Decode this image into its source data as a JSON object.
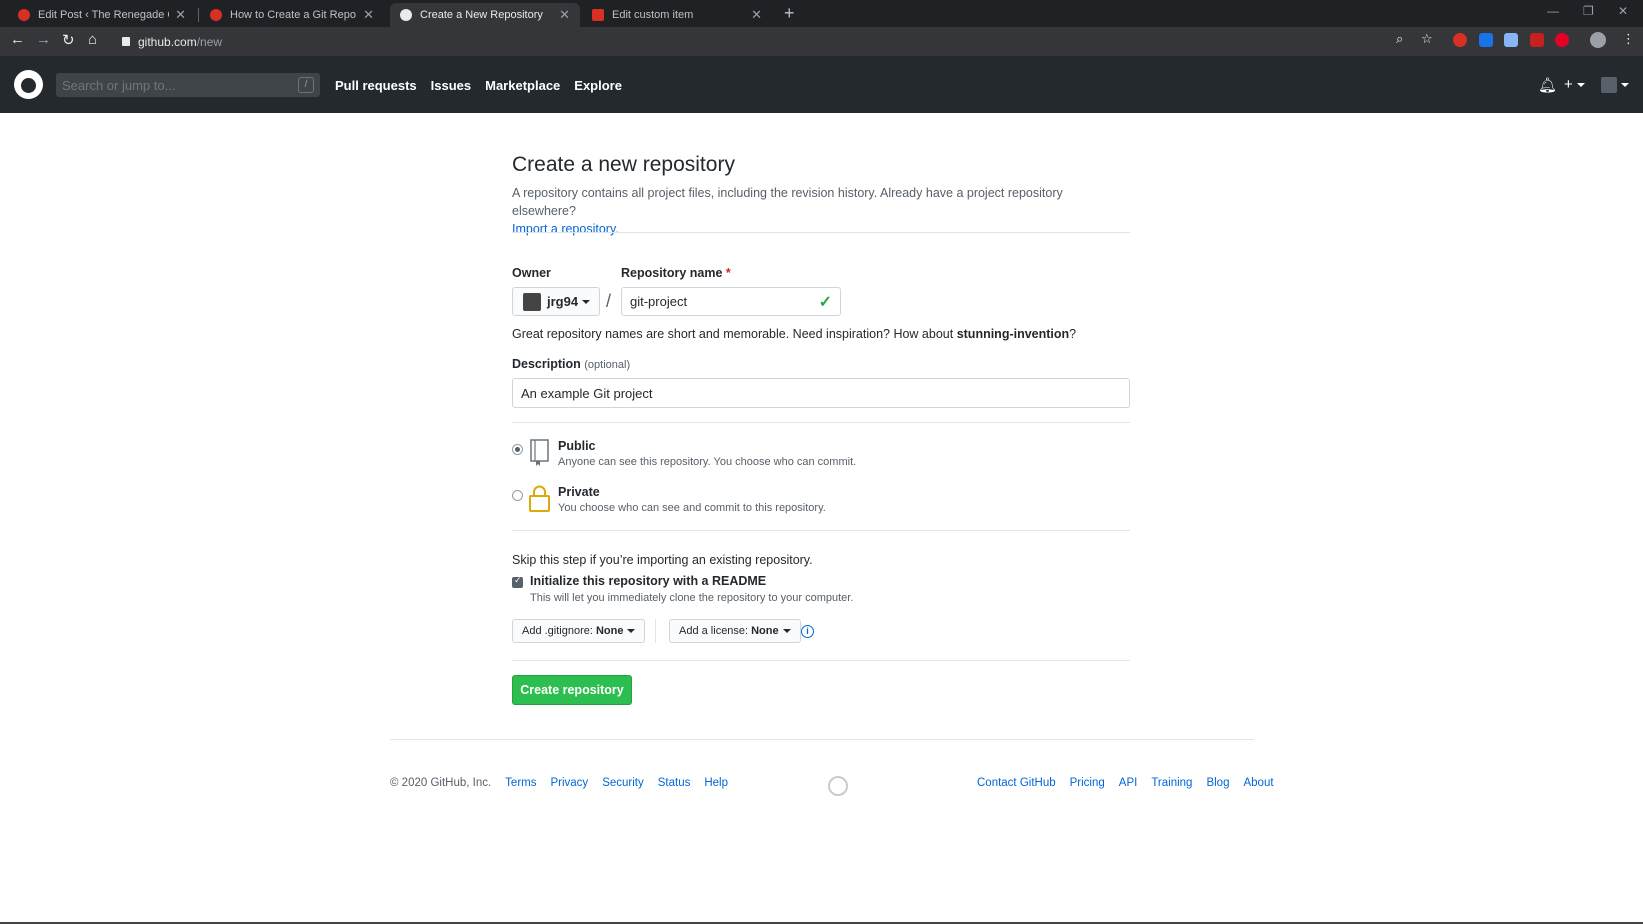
{
  "browser": {
    "tabs": [
      {
        "title": "Edit Post ‹ The Renegade Coder —",
        "active": false
      },
      {
        "title": "How to Create a Git Repo From S",
        "active": false
      },
      {
        "title": "Create a New Repository",
        "active": true
      },
      {
        "title": "Edit custom item",
        "active": false
      }
    ],
    "url_host": "github.com",
    "url_path": "/new"
  },
  "header": {
    "search_placeholder": "Search or jump to...",
    "search_shortcut": "/",
    "nav": [
      "Pull requests",
      "Issues",
      "Marketplace",
      "Explore"
    ]
  },
  "page": {
    "title": "Create a new repository",
    "lead": "A repository contains all project files, including the revision history. Already have a project repository elsewhere?",
    "import_link": "Import a repository.",
    "owner_label": "Owner",
    "owner_value": "jrg94",
    "repo_label": "Repository name",
    "repo_required": "*",
    "repo_value": "git-project",
    "name_hint_prefix": "Great repository names are short and memorable. Need inspiration? How about",
    "name_suggestion": "stunning-invention",
    "name_hint_suffix": "?",
    "description_label": "Description",
    "description_optional": "(optional)",
    "description_value": "An example Git project",
    "visibility": [
      {
        "title": "Public",
        "desc": "Anyone can see this repository. You choose who can commit.",
        "selected": true
      },
      {
        "title": "Private",
        "desc": "You choose who can see and commit to this repository.",
        "selected": false
      }
    ],
    "skip_note": "Skip this step if you’re importing an existing repository.",
    "readme_label": "Initialize this repository with a README",
    "readme_desc": "This will let you immediately clone the repository to your computer.",
    "readme_checked": true,
    "gitignore_label": "Add .gitignore:",
    "gitignore_value": "None",
    "license_label": "Add a license:",
    "license_value": "None",
    "create_button": "Create repository"
  },
  "footer": {
    "copyright": "© 2020 GitHub, Inc.",
    "left_links": [
      "Terms",
      "Privacy",
      "Security",
      "Status",
      "Help"
    ],
    "right_links": [
      "Contact GitHub",
      "Pricing",
      "API",
      "Training",
      "Blog",
      "About"
    ]
  },
  "colors": {
    "primary_green": "#2cbe4e",
    "link_blue": "#0366d6",
    "header_dark": "#24292e"
  }
}
